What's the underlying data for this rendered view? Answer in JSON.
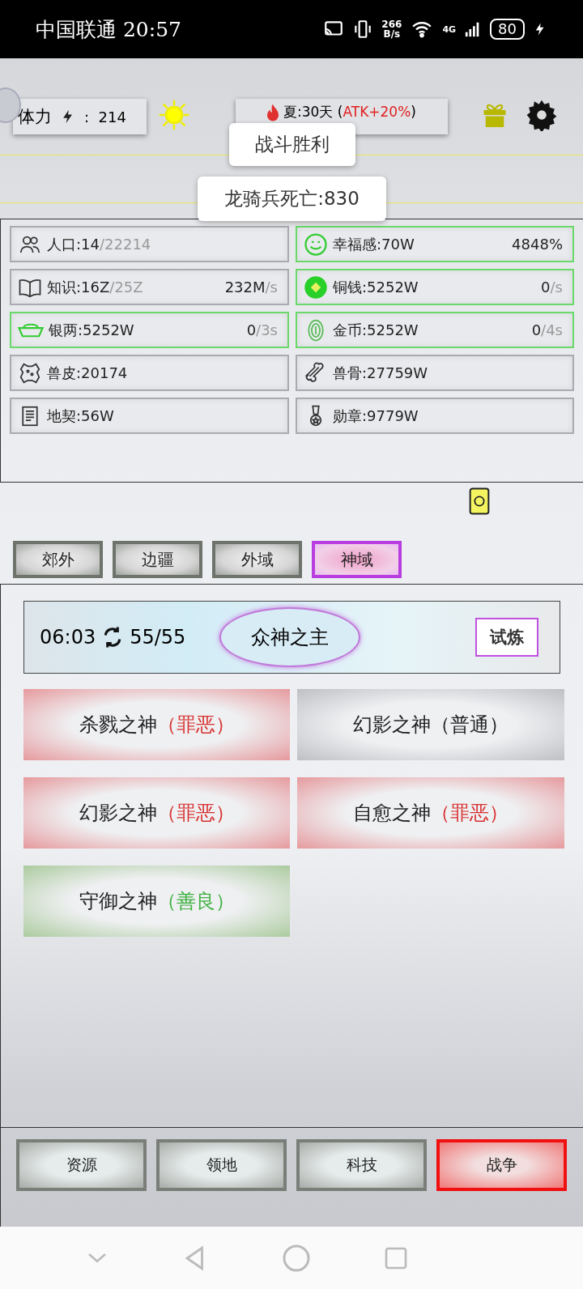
{
  "status_bar": {
    "carrier_time": "中国联通 20:57",
    "speed_value": "266",
    "speed_unit": "B/s",
    "network": "4G",
    "battery": "80"
  },
  "top_bar": {
    "stamina_label": "体力",
    "stamina_sep": ":",
    "stamina_value": "214",
    "season_text": "夏:30天 (",
    "season_bonus": "ATK+20%",
    "season_close": ")"
  },
  "toasts": [
    "战斗胜利",
    "龙骑兵死亡:830"
  ],
  "resources": [
    {
      "text": "人口:14",
      "cap": "/22214",
      "highlighted": false
    },
    {
      "text": "幸福感:70W",
      "rate": "4848%",
      "highlighted": true
    },
    {
      "text": "知识:16Z",
      "cap": "/25Z",
      "rate": "232M",
      "rate_unit": "/s",
      "highlighted": false
    },
    {
      "text": "铜钱:5252W",
      "rate": "0",
      "rate_unit": "/s",
      "highlighted": true
    },
    {
      "text": "银两:5252W",
      "rate": "0",
      "rate_unit": "/3s",
      "highlighted": true
    },
    {
      "text": "金币:5252W",
      "rate": "0",
      "rate_unit": "/4s",
      "highlighted": true
    },
    {
      "text": "兽皮:20174",
      "highlighted": false
    },
    {
      "text": "兽骨:27759W",
      "highlighted": false
    },
    {
      "text": "地契:56W",
      "highlighted": false
    },
    {
      "text": "勋章:9779W",
      "highlighted": false
    }
  ],
  "region_tabs": [
    {
      "label": "郊外",
      "selected": false
    },
    {
      "label": "边疆",
      "selected": false
    },
    {
      "label": "外域",
      "selected": false
    },
    {
      "label": "神域",
      "selected": true
    }
  ],
  "boss_panel": {
    "timer": "06:03",
    "count": "55/55",
    "boss_name": "众神之主",
    "trial_button": "试炼"
  },
  "gods": [
    {
      "name": "杀戮之神",
      "alignment": "（罪恶）",
      "kind": "evil"
    },
    {
      "name": "幻影之神",
      "alignment": "（普通）",
      "kind": "neutral"
    },
    {
      "name": "幻影之神",
      "alignment": "（罪恶）",
      "kind": "evil"
    },
    {
      "name": "自愈之神",
      "alignment": "（罪恶）",
      "kind": "evil"
    },
    {
      "name": "守御之神",
      "alignment": "（善良）",
      "kind": "good"
    }
  ],
  "bottom_nav": [
    {
      "label": "资源",
      "selected": false
    },
    {
      "label": "领地",
      "selected": false
    },
    {
      "label": "科技",
      "selected": false
    },
    {
      "label": "战争",
      "selected": true
    }
  ]
}
